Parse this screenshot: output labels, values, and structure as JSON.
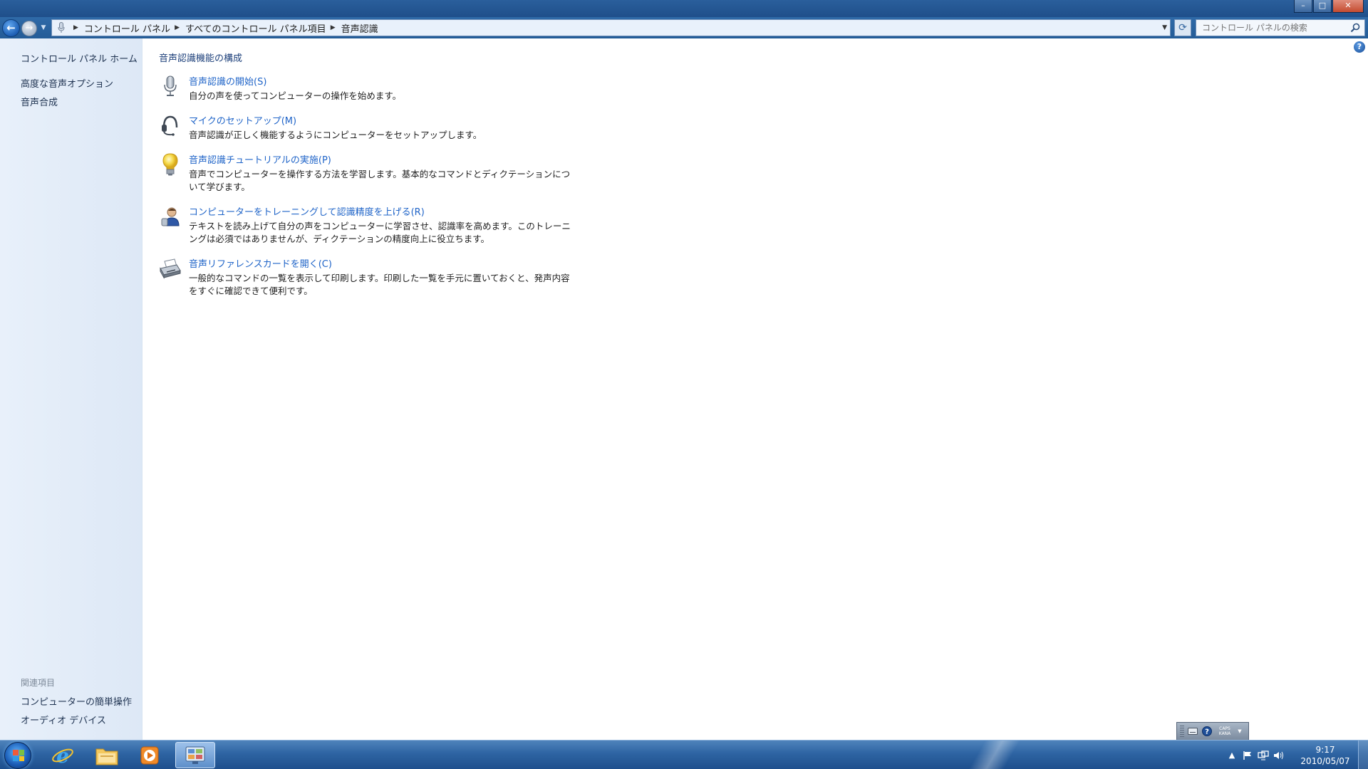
{
  "window": {
    "minimize_label": "–",
    "maximize_label": "□",
    "close_label": "✕"
  },
  "navigation": {
    "back_icon": "back-arrow-icon",
    "forward_icon": "forward-arrow-icon",
    "breadcrumbs": [
      "コントロール パネル",
      "すべてのコントロール パネル項目",
      "音声認識"
    ],
    "search_placeholder": "コントロール パネルの検索"
  },
  "sidebar": {
    "home_link": "コントロール パネル ホーム",
    "links": [
      "高度な音声オプション",
      "音声合成"
    ],
    "related_heading": "関連項目",
    "related_links": [
      "コンピューターの簡単操作",
      "オーディオ デバイス"
    ]
  },
  "main": {
    "section_title": "音声認識機能の構成",
    "tasks": [
      {
        "icon": "microphone-icon",
        "title": "音声認識の開始(S)",
        "description": "自分の声を使ってコンピューターの操作を始めます。"
      },
      {
        "icon": "headset-icon",
        "title": "マイクのセットアップ(M)",
        "description": "音声認識が正しく機能するようにコンピューターをセットアップします。"
      },
      {
        "icon": "lightbulb-icon",
        "title": "音声認識チュートリアルの実施(P)",
        "description": "音声でコンピューターを操作する方法を学習します。基本的なコマンドとディクテーションについて学びます。"
      },
      {
        "icon": "user-training-icon",
        "title": "コンピューターをトレーニングして認識精度を上げる(R)",
        "description": "テキストを読み上げて自分の声をコンピューターに学習させ、認識率を高めます。このトレーニングは必須ではありませんが、ディクテーションの精度向上に役立ちます。"
      },
      {
        "icon": "printer-icon",
        "title": "音声リファレンスカードを開く(C)",
        "description": "一般的なコマンドの一覧を表示して印刷します。印刷した一覧を手元に置いておくと、発声内容をすぐに確認できて便利です。"
      }
    ]
  },
  "langbar": {
    "caps_label": "CAPS",
    "kana_label": "KANA"
  },
  "taskbar": {
    "time": "9:17",
    "date": "2010/05/07"
  },
  "colors": {
    "link": "#1f64c8",
    "section_title": "#1c3f7a",
    "sidebar_bg": "#e8f0fa",
    "taskbar": "#2e64a3"
  }
}
